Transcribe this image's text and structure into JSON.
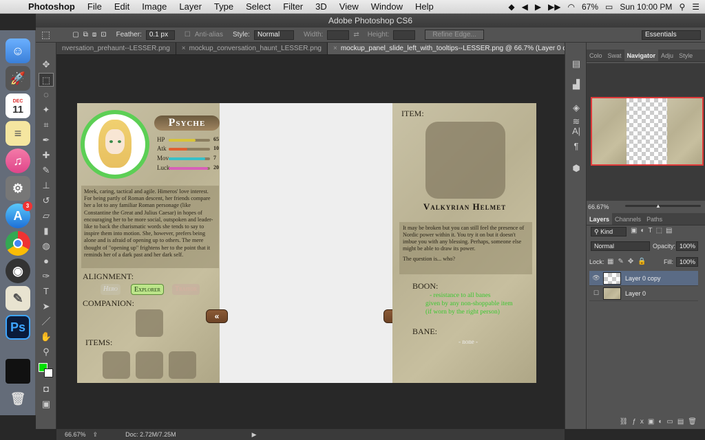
{
  "menubar": {
    "app": "Photoshop",
    "items": [
      "File",
      "Edit",
      "Image",
      "Layer",
      "Type",
      "Select",
      "Filter",
      "3D",
      "View",
      "Window",
      "Help"
    ],
    "battery": "67%",
    "clock": "Sun 10:00 PM"
  },
  "window": {
    "title": "Adobe Photoshop CS6"
  },
  "options": {
    "feather_label": "Feather:",
    "feather_value": "0.1 px",
    "antialias_label": "Anti-alias",
    "style_label": "Style:",
    "style_value": "Normal",
    "width_label": "Width:",
    "height_label": "Height:",
    "refine_edge": "Refine Edge...",
    "workspace": "Essentials"
  },
  "tabs": [
    {
      "label": "nversation_prehaunt--LESSER.png"
    },
    {
      "label": "mockup_conversation_haunt_LESSER.png"
    },
    {
      "label": "mockup_panel_slide_left_with_tooltips--LESSER.png @ 66.7% (Layer 0 copy, RGB/8) *"
    }
  ],
  "character": {
    "name": "Psyche",
    "stats": [
      {
        "label": "HP",
        "value": "65",
        "color": "#d8c43a",
        "fill": 0.65
      },
      {
        "label": "Atk",
        "value": "10",
        "color": "#e06030",
        "fill": 0.45
      },
      {
        "label": "Mov",
        "value": "7",
        "color": "#38c0c8",
        "fill": 0.88
      },
      {
        "label": "Luck",
        "value": "20",
        "color": "#d860b8",
        "fill": 0.95
      }
    ],
    "description": "Meek, caring, tactical and agile. Himeros' love interest. For being partly of Roman descent, her friends compare her a lot to any familiar Roman personage (like Constantine the Great and Julius Caesar) in hopes of encouraging her to be more social, outspoken and leader-like to back the charismatic words she tends to say to inspire them into motion. She, however, prefers being alone and is afraid of opening up to others. The mere thought of \"opening up\" frightens her to the point that it reminds her of a dark past and her dark self.",
    "alignment_label": "ALIGNMENT:",
    "alignments": [
      "Hero",
      "Explorer",
      "Traitor"
    ],
    "companion_label": "COMPANION:",
    "items_label": "ITEMS:"
  },
  "nav": {
    "prev": "«",
    "next": "»"
  },
  "item": {
    "label": "ITEM:",
    "name": "Valkyrian Helmet",
    "description_1": "It may be broken but you can still feel the presence of Nordic power within it. You try it on but it doesn't imbue you with any blessing. Perhaps, someone else might be able to  draw its power.",
    "description_2": "The question is... who?",
    "boon_label": "BOON:",
    "boons": [
      "- resistance to all banes",
      "given by any non-shoppable item",
      "(if worn by the right person)"
    ],
    "bane_label": "BANE:",
    "bane_value": "- none -"
  },
  "panels": {
    "top_tabs": [
      "Colo",
      "Swat",
      "Navigator",
      "Adju",
      "Style"
    ],
    "zoom": "66.67%",
    "layer_tabs": [
      "Layers",
      "Channels",
      "Paths"
    ],
    "kind": "Kind",
    "blend": "Normal",
    "opacity_label": "Opacity:",
    "opacity": "100%",
    "lock_label": "Lock:",
    "fill_label": "Fill:",
    "fill": "100%",
    "layers": [
      "Layer 0 copy",
      "Layer 0"
    ]
  },
  "status": {
    "zoom": "66.67%",
    "doc": "Doc: 2.72M/7.25M"
  },
  "dock": {
    "calendar_month": "DEC",
    "calendar_day": "11",
    "appstore_badge": "3",
    "ps_label": "Ps"
  }
}
